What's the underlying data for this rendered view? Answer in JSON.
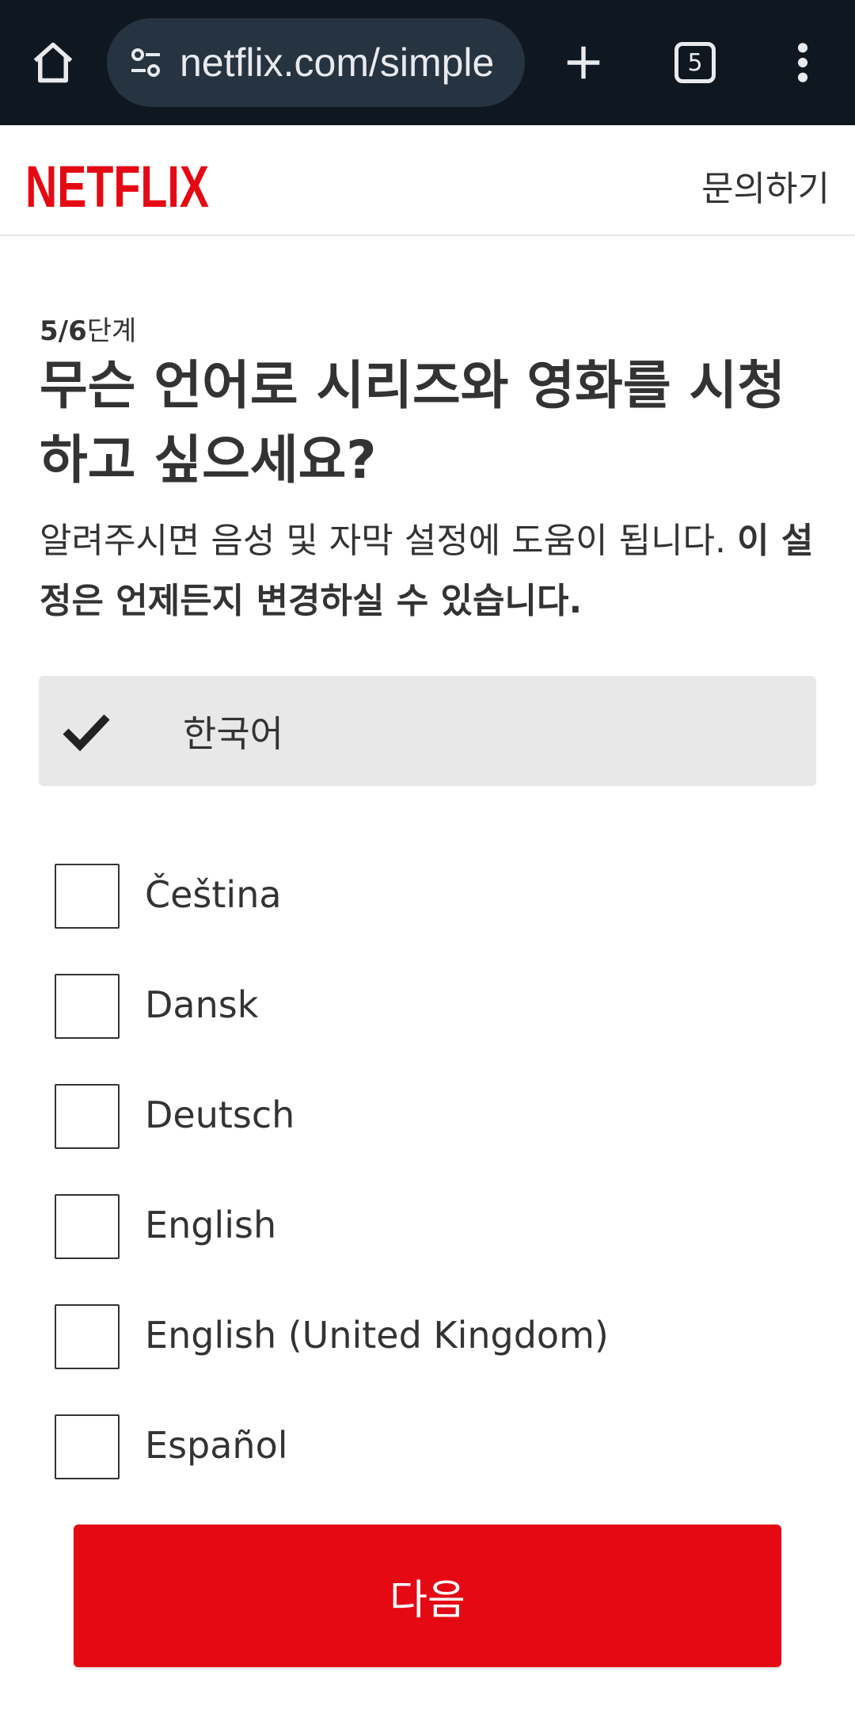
{
  "browser": {
    "url": "netflix.com/simple",
    "tab_count": "5",
    "icons": {
      "home": "home-icon",
      "site_info": "tune-icon",
      "new_tab": "plus-icon",
      "tabs": "tabs-icon",
      "menu": "more-vert-icon"
    }
  },
  "header": {
    "logo_text": "NETFLIX",
    "help_label": "문의하기",
    "brand_color": "#e50914"
  },
  "content": {
    "step_current": "5/6",
    "step_suffix": "단계",
    "title": "무슨 언어로 시리즈와 영화를 시청하고 싶으세요?",
    "description": "알려주시면 음성 및 자막 설정에 도움이 됩니다. ",
    "description_bold": "이 설정은 언제든지 변경하실 수 있습니다.",
    "selected_language": "한국어",
    "languages": [
      "Čeština",
      "Dansk",
      "Deutsch",
      "English",
      "English (United Kingdom)",
      "Español"
    ]
  },
  "footer": {
    "next_label": "다음"
  }
}
